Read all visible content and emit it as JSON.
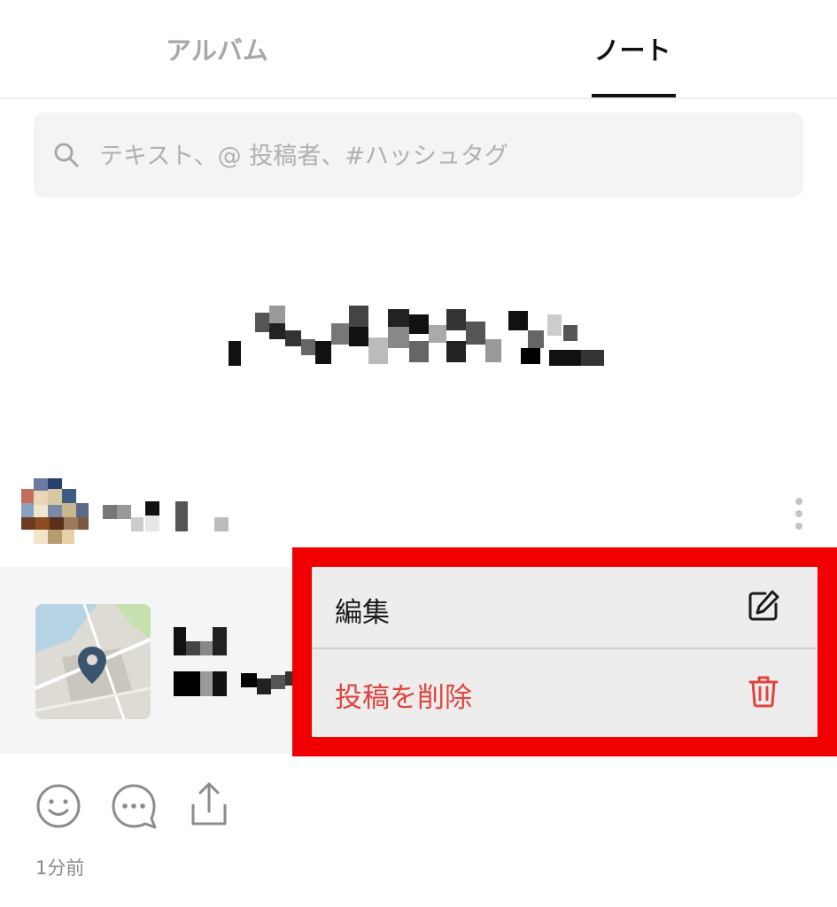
{
  "tabs": [
    {
      "label": "アルバム",
      "active": false
    },
    {
      "label": "ノート",
      "active": true
    }
  ],
  "search": {
    "placeholder": "テキスト、@ 投稿者、#ハッシュタグ",
    "icon": "search-icon"
  },
  "post": {
    "timestamp": "1分前",
    "more_icon": "more-vertical-icon",
    "actions": [
      "smiley-icon",
      "comment-icon",
      "share-icon"
    ]
  },
  "context_menu": {
    "items": [
      {
        "label": "編集",
        "icon": "edit-icon",
        "color": "#1a1a1a"
      },
      {
        "label": "投稿を削除",
        "icon": "trash-icon",
        "color": "#e0443e"
      }
    ]
  },
  "colors": {
    "highlight_border": "#f00000",
    "delete": "#e0443e",
    "icon_gray": "#8c8c8c"
  }
}
